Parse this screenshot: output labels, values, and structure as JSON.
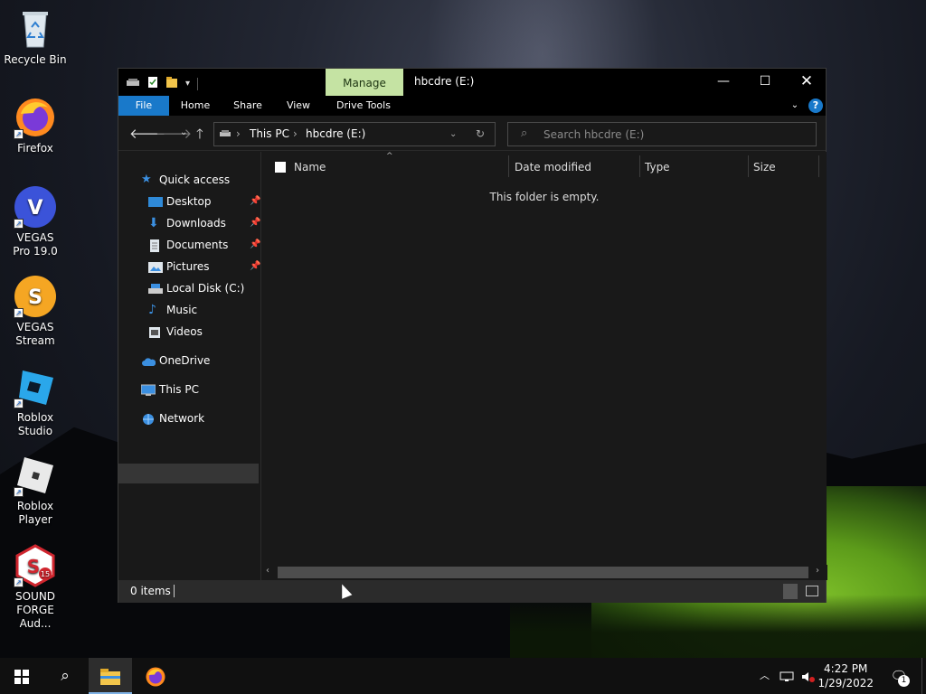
{
  "desktop": {
    "icons": [
      {
        "label": "Recycle Bin"
      },
      {
        "label": "Firefox"
      },
      {
        "label": "VEGAS Pro 19.0"
      },
      {
        "label": "VEGAS Stream"
      },
      {
        "label": "Roblox Studio"
      },
      {
        "label": "Roblox Player"
      },
      {
        "label": "SOUND FORGE Aud..."
      }
    ]
  },
  "window": {
    "title": "hbcdre (E:)",
    "contextual_tab": "Manage",
    "ribbon_tabs": [
      "File",
      "Home",
      "Share",
      "View",
      "Drive Tools"
    ],
    "help": "?",
    "address": {
      "segments": [
        "This PC",
        "hbcdre (E:)"
      ]
    },
    "search": {
      "placeholder": "Search hbcdre (E:)"
    },
    "nav": {
      "quick_access": "Quick access",
      "items": [
        "Desktop",
        "Downloads",
        "Documents",
        "Pictures",
        "Local Disk (C:)",
        "Music",
        "Videos"
      ],
      "onedrive": "OneDrive",
      "this_pc": "This PC",
      "network": "Network"
    },
    "columns": [
      "Name",
      "Date modified",
      "Type",
      "Size"
    ],
    "empty_message": "This folder is empty.",
    "status": {
      "items": "0 items"
    }
  },
  "taskbar": {
    "time": "4:22 PM",
    "date": "1/29/2022",
    "notification_count": "1"
  },
  "colors": {
    "file_tab": "#1979ca",
    "manage_tab": "#c5e3a3",
    "window_bg": "#191919",
    "selected_nav": "#363636"
  }
}
